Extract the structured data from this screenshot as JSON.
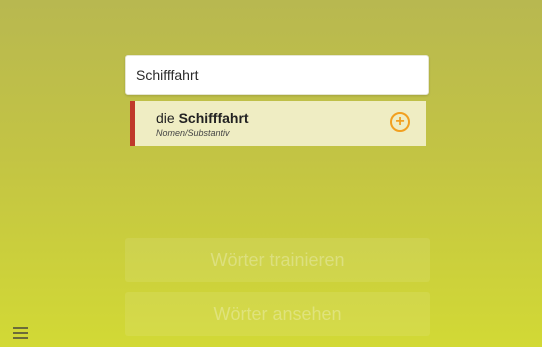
{
  "search": {
    "value": "Schifffahrt",
    "placeholder": ""
  },
  "suggestion": {
    "article": "die",
    "word": "Schifffahrt",
    "word_type": "Nomen/Substantiv",
    "add_symbol": "+",
    "accent_color": "#c0392b",
    "add_color": "#f2a020"
  },
  "actions": {
    "train_label": "Wörter trainieren",
    "view_label": "Wörter ansehen"
  },
  "icons": {
    "menu": "hamburger-menu-icon",
    "add": "add-circle-icon"
  }
}
